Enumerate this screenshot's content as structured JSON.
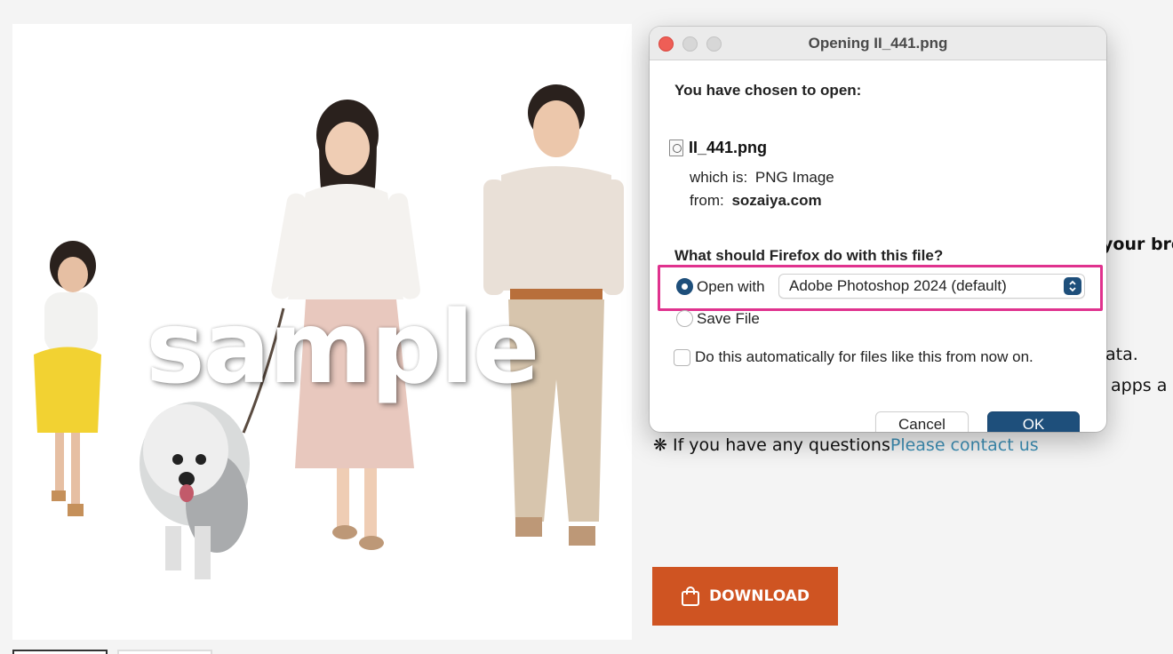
{
  "image": {
    "watermark": "sample"
  },
  "background": {
    "partial_heading": "your bro",
    "partial_line1": "ata.",
    "partial_line2": "apps a",
    "contact_prefix": "❋ If you have any questions",
    "contact_link": "Please contact us",
    "download_label": "DOWNLOAD"
  },
  "dialog": {
    "title": "Opening II_441.png",
    "chosen_heading": "You have chosen to open:",
    "file_name": "II_441.png",
    "which_is_label": "which is:",
    "which_is_value": "PNG Image",
    "from_label": "from:",
    "from_value": "sozaiya.com",
    "question": "What should Firefox do with this file?",
    "open_with_label": "Open with",
    "open_with_app": "Adobe Photoshop 2024 (default)",
    "open_with_selected": true,
    "save_file_label": "Save File",
    "auto_label": "Do this automatically for files like this from now on.",
    "auto_checked": false,
    "cancel_label": "Cancel",
    "ok_label": "OK"
  },
  "colors": {
    "download_button": "#cf5422",
    "link": "#3d8fb5",
    "highlight_box": "#e0328e",
    "ok_button": "#1e4f7b",
    "close_light": "#ee5e56"
  }
}
